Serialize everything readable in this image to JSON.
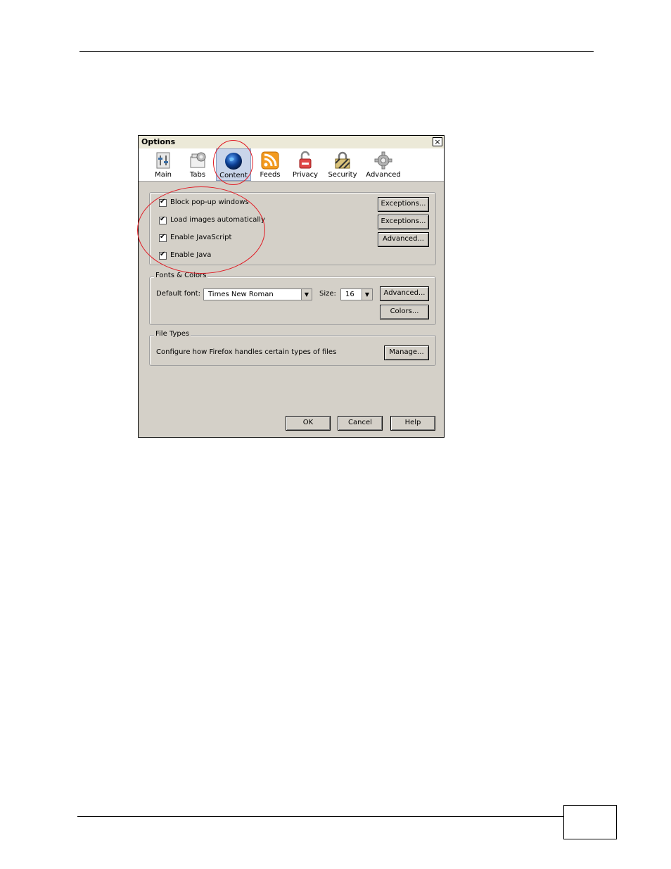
{
  "dialog": {
    "title": "Options",
    "close_glyph": "×"
  },
  "toolbar": {
    "items": [
      {
        "label": "Main",
        "icon": "main-icon"
      },
      {
        "label": "Tabs",
        "icon": "tabs-icon"
      },
      {
        "label": "Content",
        "icon": "content-globe-icon",
        "selected": true
      },
      {
        "label": "Feeds",
        "icon": "feeds-icon"
      },
      {
        "label": "Privacy",
        "icon": "privacy-icon"
      },
      {
        "label": "Security",
        "icon": "security-icon"
      },
      {
        "label": "Advanced",
        "icon": "advanced-gear-icon"
      }
    ]
  },
  "content": {
    "block_popups": "Block pop-up windows",
    "load_images": "Load images automatically",
    "enable_javascript": "Enable JavaScript",
    "enable_java": "Enable Java",
    "exceptions1": "Exceptions...",
    "exceptions2": "Exceptions...",
    "advanced_js": "Advanced..."
  },
  "fonts": {
    "legend": "Fonts & Colors",
    "default_font_label": "Default font:",
    "default_font_value": "Times New Roman",
    "size_label": "Size:",
    "size_value": "16",
    "advanced": "Advanced...",
    "colors": "Colors..."
  },
  "filetypes": {
    "legend": "File Types",
    "description": "Configure how Firefox handles certain types of files",
    "manage": "Manage..."
  },
  "footer": {
    "ok": "OK",
    "cancel": "Cancel",
    "help": "Help"
  },
  "colors": {
    "annotation": "#e01b24",
    "dialog_bg": "#d4d0c8"
  }
}
